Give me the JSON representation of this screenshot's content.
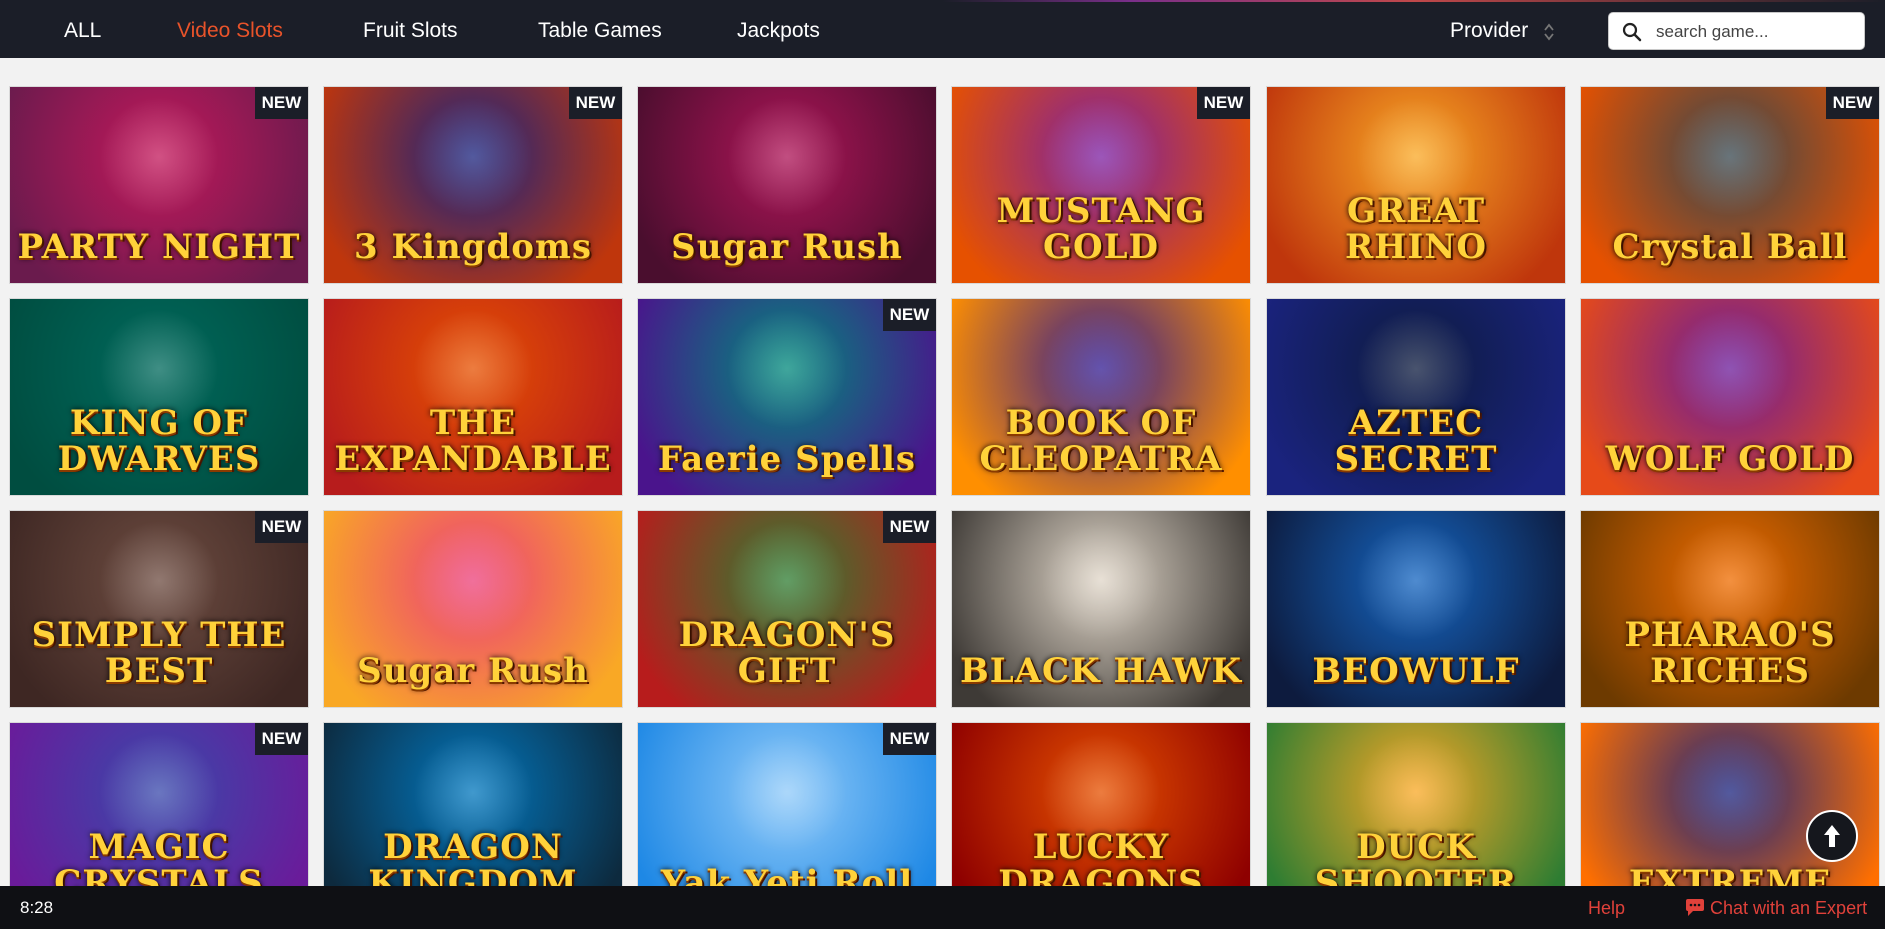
{
  "nav": {
    "items": [
      "ALL",
      "Video Slots",
      "Fruit Slots",
      "Table Games",
      "Jackpots"
    ],
    "active_index": 1,
    "provider_label": "Provider",
    "search_placeholder": "search game..."
  },
  "colors": {
    "nav_bg": "#1b1e28",
    "accent": "#e8532a",
    "footer_link": "#e0413a"
  },
  "games": [
    {
      "title": "PARTY NIGHT",
      "badge": "NEW",
      "bg": [
        "#c2185b",
        "#6a1b4d"
      ]
    },
    {
      "title": "3 Kingdoms",
      "badge": "NEW",
      "bg": [
        "#1a237e",
        "#bf360c"
      ]
    },
    {
      "title": "Sugar Rush",
      "badge": "",
      "bg": [
        "#ad1457",
        "#4a0e2e"
      ]
    },
    {
      "title": "MUSTANG GOLD",
      "badge": "NEW",
      "bg": [
        "#7b1fa2",
        "#e65100"
      ]
    },
    {
      "title": "GREAT RHINO",
      "badge": "",
      "bg": [
        "#f9a825",
        "#bf360c"
      ]
    },
    {
      "title": "Crystal Ball",
      "badge": "NEW",
      "bg": [
        "#37474f",
        "#e65100"
      ]
    },
    {
      "title": "KING OF DWARVES",
      "badge": "",
      "bg": [
        "#00695c",
        "#004d40"
      ]
    },
    {
      "title": "THE EXPANDABLE",
      "badge": "",
      "bg": [
        "#e65100",
        "#b71c1c"
      ]
    },
    {
      "title": "Faerie Spells",
      "badge": "NEW",
      "bg": [
        "#00897b",
        "#4a148c"
      ]
    },
    {
      "title": "BOOK OF CLEOPATRA",
      "badge": "",
      "bg": [
        "#311b92",
        "#ff8f00"
      ]
    },
    {
      "title": "AZTEC SECRET",
      "badge": "",
      "bg": [
        "#0d1b3e",
        "#1a237e"
      ]
    },
    {
      "title": "WOLF GOLD",
      "badge": "",
      "bg": [
        "#6a1b9a",
        "#e64a19"
      ]
    },
    {
      "title": "SIMPLY THE BEST",
      "badge": "NEW",
      "bg": [
        "#6d4c41",
        "#3e2723"
      ]
    },
    {
      "title": "Sugar Rush",
      "badge": "",
      "bg": [
        "#ec407a",
        "#f9a825"
      ]
    },
    {
      "title": "DRAGON'S GIFT",
      "badge": "NEW",
      "bg": [
        "#2e7d32",
        "#b71c1c"
      ]
    },
    {
      "title": "BLACK HAWK",
      "badge": "",
      "bg": [
        "#e0d6c8",
        "#3e3a36"
      ]
    },
    {
      "title": "BEOWULF",
      "badge": "",
      "bg": [
        "#1565c0",
        "#0d1b3e"
      ]
    },
    {
      "title": "PHARAO'S RICHES",
      "badge": "",
      "bg": [
        "#ef6c00",
        "#6d3a00"
      ]
    },
    {
      "title": "MAGIC CRYSTALS",
      "badge": "NEW",
      "bg": [
        "#3949ab",
        "#6a1b9a"
      ]
    },
    {
      "title": "DRAGON KINGDOM",
      "badge": "",
      "bg": [
        "#0277bd",
        "#0d2a3e"
      ]
    },
    {
      "title": "Yak Yeti Roll",
      "badge": "NEW",
      "bg": [
        "#90caf9",
        "#1e88e5"
      ]
    },
    {
      "title": "LUCKY DRAGONS",
      "badge": "",
      "bg": [
        "#e65100",
        "#8e0000"
      ]
    },
    {
      "title": "DUCK SHOOTER",
      "badge": "",
      "bg": [
        "#f9a825",
        "#2e7d32"
      ]
    },
    {
      "title": "EXTREME",
      "badge": "",
      "bg": [
        "#1a237e",
        "#ff6f00"
      ]
    }
  ],
  "footer": {
    "time": "8:28",
    "help_label": "Help",
    "chat_label": "Chat with an Expert"
  }
}
